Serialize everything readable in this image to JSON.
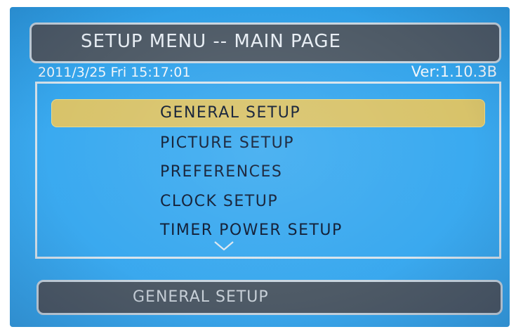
{
  "header": {
    "title": "SETUP MENU -- MAIN PAGE",
    "datetime": "2011/3/25 Fri 15:17:01",
    "version": "Ver:1.10.3B"
  },
  "menu": {
    "items": [
      {
        "label": "GENERAL SETUP",
        "selected": true
      },
      {
        "label": "PICTURE SETUP",
        "selected": false
      },
      {
        "label": "PREFERENCES",
        "selected": false
      },
      {
        "label": "CLOCK SETUP",
        "selected": false
      },
      {
        "label": "TIMER POWER SETUP",
        "selected": false
      }
    ],
    "more_indicator_icon": "chevron-down-icon"
  },
  "footer": {
    "description": "GENERAL SETUP"
  },
  "colors": {
    "screen_background": "#3aa8ee",
    "bar_background": "#4e5a66",
    "highlight": "#d8c36a",
    "menu_text": "#0b1830"
  }
}
